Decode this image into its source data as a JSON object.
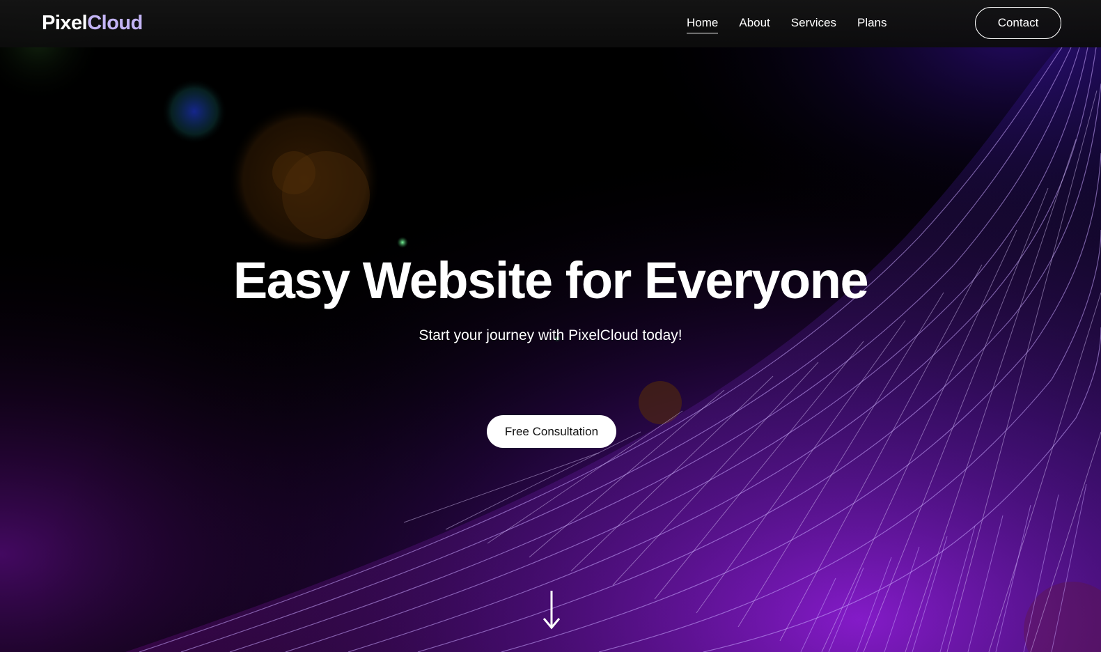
{
  "brand": {
    "name_part1": "Pixel",
    "name_part2": "Cloud"
  },
  "nav": {
    "items": [
      {
        "label": "Home",
        "active": true
      },
      {
        "label": "About",
        "active": false
      },
      {
        "label": "Services",
        "active": false
      },
      {
        "label": "Plans",
        "active": false
      }
    ],
    "contact_label": "Contact"
  },
  "hero": {
    "title": "Easy Website for Everyone",
    "subtitle": "Start your journey with PixelCloud today!",
    "cta_label": "Free Consultation"
  },
  "icons": {
    "scroll": "arrow-down-icon"
  },
  "colors": {
    "background": "#000000",
    "accent_purple": "#8a2be2",
    "logo_accent": "#c3b4f4",
    "text": "#ffffff"
  }
}
